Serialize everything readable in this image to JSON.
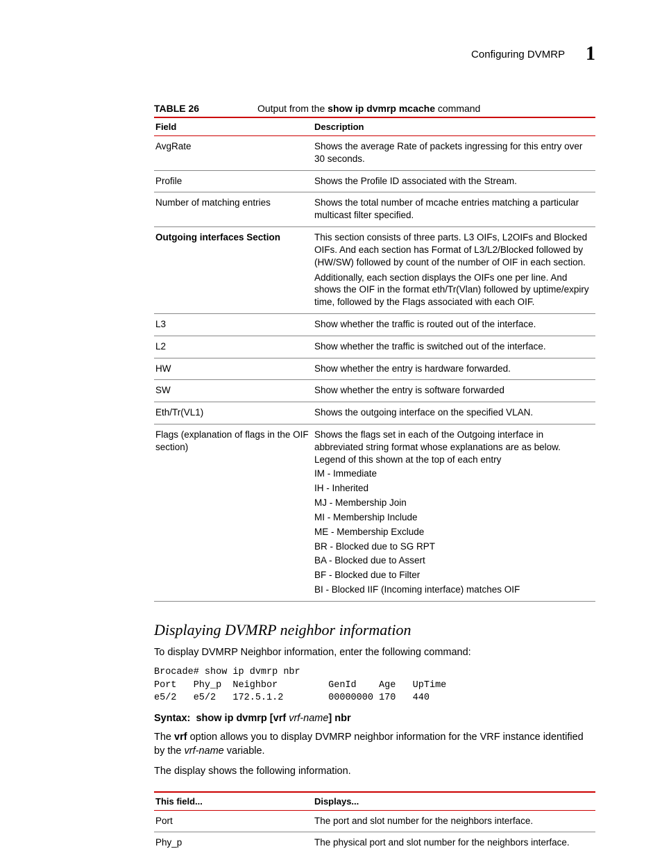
{
  "header": {
    "title": "Configuring DVMRP",
    "chapter": "1"
  },
  "table_caption": {
    "label": "TABLE 26",
    "text_pre": "Output from the ",
    "text_bold": "show ip dvmrp mcache",
    "text_post": " command"
  },
  "table1": {
    "head": {
      "c1": "Field",
      "c2": "Description"
    },
    "rows": [
      {
        "c1": "AvgRate",
        "c2": "Shows the average Rate of packets ingressing for this entry over 30 seconds."
      },
      {
        "c1": "Profile",
        "c2": "Shows the Profile ID associated with the Stream."
      },
      {
        "c1": "Number of matching entries",
        "c2": "Shows the total number of mcache entries matching a particular multicast filter specified."
      },
      {
        "c1": "Outgoing interfaces Section",
        "c1_bold": true,
        "c2a": "This section consists of three parts. L3 OIFs, L2OIFs and Blocked OIFs. And each section has Format of L3/L2/Blocked followed by (HW/SW) followed by count of the number of OIF in each section.",
        "c2b": "Additionally, each section displays the OIFs one per line. And shows the OIF in the format eth/Tr(Vlan) followed by uptime/expiry time, followed by the Flags associated with each OIF."
      },
      {
        "c1": "L3",
        "c2": "Show whether the traffic is routed out of the interface."
      },
      {
        "c1": "L2",
        "c2": "Show whether the traffic is switched out of the interface."
      },
      {
        "c1": "HW",
        "c2": "Show whether the entry is hardware forwarded."
      },
      {
        "c1": "SW",
        "c2": "Show whether the entry is software forwarded"
      },
      {
        "c1": "Eth/Tr(VL1)",
        "c2": "Shows the outgoing interface on the specified VLAN."
      },
      {
        "c1": "Flags  (explanation of flags in the OIF section)",
        "c2": "Shows the flags set in each of the Outgoing interface in abbreviated string format whose explanations are as below. Legend of this shown at the top of each entry",
        "flags": [
          "IM - Immediate",
          "IH  - Inherited",
          "MJ - Membership Join",
          "MI - Membership Include",
          "ME - Membership Exclude",
          "BR - Blocked due to SG RPT",
          "BA - Blocked due to Assert",
          "BF - Blocked due to Filter",
          " BI - Blocked IIF (Incoming interface) matches OIF"
        ]
      }
    ]
  },
  "section_heading": "Displaying DVMRP neighbor information",
  "intro_para": "To display DVMRP Neighbor information, enter the following command:",
  "cli": "Brocade# show ip dvmrp nbr\nPort   Phy_p  Neighbor         GenId    Age   UpTime\ne5/2   e5/2   172.5.1.2        00000000 170   440",
  "syntax": {
    "label": "Syntax:",
    "cmd1": "show ip dvmrp [vrf ",
    "var": "vrf-name",
    "cmd2": "] nbr"
  },
  "para_vrf_pre": "The ",
  "para_vrf_bold": "vrf",
  "para_vrf_mid": " option allows you to display DVMRP neighbor information for the VRF instance identified by the ",
  "para_vrf_var": "vrf-name",
  "para_vrf_post": " variable.",
  "para_display": "The display shows the following information.",
  "table2": {
    "head": {
      "c1": "This field...",
      "c2": "Displays..."
    },
    "rows": [
      {
        "c1": "Port",
        "c2": "The port and slot number for the neighbors interface."
      },
      {
        "c1": "Phy_p",
        "c2": "The physical port and slot number for the neighbors interface."
      }
    ]
  }
}
